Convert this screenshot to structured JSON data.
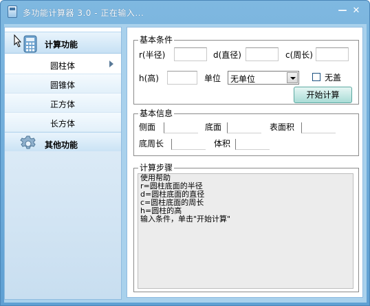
{
  "window": {
    "title": "多功能计算器 3.0 - 正在输入...",
    "minimize_glyph": "—",
    "close_glyph": "✕"
  },
  "sidebar": {
    "sections": [
      {
        "label": "计算功能",
        "icon": "calculator-icon"
      },
      {
        "label": "其他功能",
        "icon": "gear-icon"
      }
    ],
    "items": [
      {
        "label": "圆柱体",
        "active": true
      },
      {
        "label": "圆锥体",
        "active": false
      },
      {
        "label": "正方体",
        "active": false
      },
      {
        "label": "长方体",
        "active": false
      }
    ]
  },
  "conditions": {
    "title": "基本条件",
    "r_label": "r(半径)",
    "r_value": "",
    "d_label": "d(直径)",
    "d_value": "",
    "c_label": "c(周长)",
    "c_value": "",
    "h_label": "h(高)",
    "h_value": "",
    "unit_label": "单位",
    "unit_value": "无单位",
    "no_lid_label": "无盖",
    "no_lid_checked": false,
    "start_button": "开始计算"
  },
  "info": {
    "title": "基本信息",
    "side_label": "侧面",
    "side_value": "",
    "base_label": "底面",
    "base_value": "",
    "surface_label": "表面积",
    "surface_value": "",
    "perimeter_label": "底周长",
    "perimeter_value": "",
    "volume_label": "体积",
    "volume_value": ""
  },
  "steps": {
    "title": "计算步骤",
    "lines": [
      "使用帮助",
      "r=圆柱底面的半径",
      "d=圆柱底面的直径",
      "c=圆柱底面的周长",
      "h=圆柱的高",
      "输入条件，单击\"开始计算\""
    ]
  }
}
